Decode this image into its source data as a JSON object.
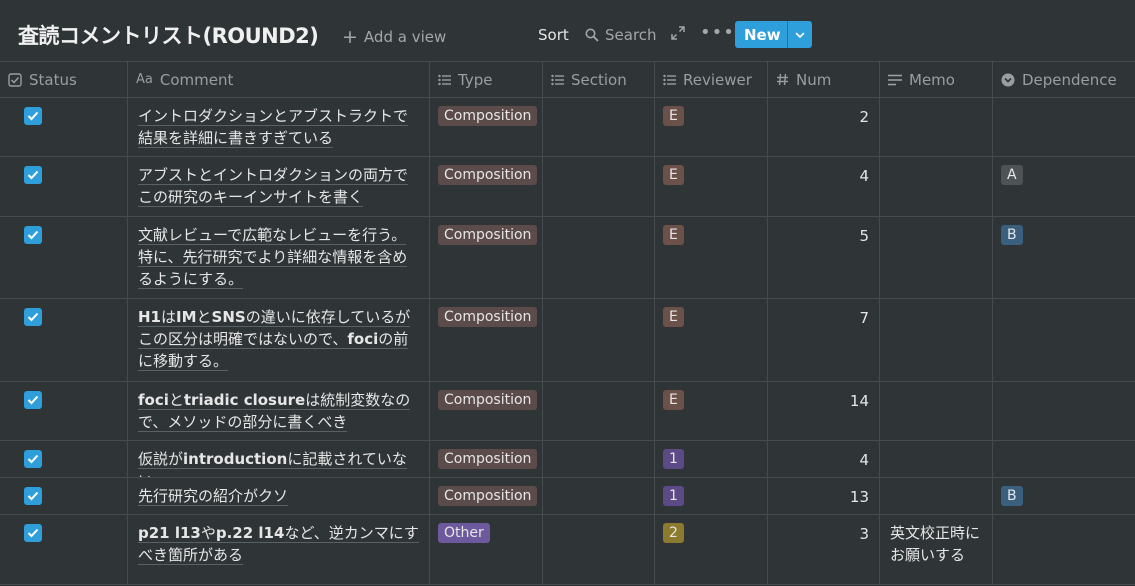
{
  "header": {
    "title": "査読コメントリスト(ROUND2)",
    "add_view": "Add a view",
    "sort": "Sort",
    "search": "Search",
    "new_button": "New"
  },
  "columns": {
    "status": "Status",
    "comment": "Comment",
    "type": "Type",
    "section": "Section",
    "reviewer": "Reviewer",
    "num": "Num",
    "memo": "Memo",
    "dependence": "Dependence"
  },
  "tag_colors": {
    "Composition": "#5c4b4b",
    "Other": "#6d5a9e",
    "E": "#6b5149",
    "1": "#5c4a86",
    "2": "#8c7a2f",
    "A": "#4e5356",
    "B": "#3a5f7f"
  },
  "rows": [
    {
      "status": true,
      "comment": "イントロダクションとアブストラクトで結果を詳細に書きすぎている",
      "type": "Composition",
      "section": "",
      "reviewer": "E",
      "num": "2",
      "memo": "",
      "dependence": ""
    },
    {
      "status": true,
      "comment": "アブストとイントロダクションの両方でこの研究のキーインサイトを書く",
      "type": "Composition",
      "section": "",
      "reviewer": "E",
      "num": "4",
      "memo": "",
      "dependence": "A"
    },
    {
      "status": true,
      "comment": "文献レビューで広範なレビューを行う。特に、先行研究でより詳細な情報を含めるようにする。",
      "type": "Composition",
      "section": "",
      "reviewer": "E",
      "num": "5",
      "memo": "",
      "dependence": "B"
    },
    {
      "status": true,
      "comment": "H1はIMとSNSの違いに依存しているがこの区分は明確ではないので、fociの前に移動する。",
      "type": "Composition",
      "section": "",
      "reviewer": "E",
      "num": "7",
      "memo": "",
      "dependence": ""
    },
    {
      "status": true,
      "comment": "fociとtriadic closureは統制変数なので、メソッドの部分に書くべき",
      "type": "Composition",
      "section": "",
      "reviewer": "E",
      "num": "14",
      "memo": "",
      "dependence": ""
    },
    {
      "status": true,
      "comment": "仮説がintroductionに記載されていない",
      "type": "Composition",
      "section": "",
      "reviewer": "1",
      "num": "4",
      "memo": "",
      "dependence": ""
    },
    {
      "status": true,
      "comment": "先行研究の紹介がクソ",
      "type": "Composition",
      "section": "",
      "reviewer": "1",
      "num": "13",
      "memo": "",
      "dependence": "B"
    },
    {
      "status": true,
      "comment": "p21 l13やp.22 l14など、逆カンマにすべき箇所がある",
      "type": "Other",
      "section": "",
      "reviewer": "2",
      "num": "3",
      "memo": "英文校正時にお願いする",
      "dependence": ""
    }
  ]
}
